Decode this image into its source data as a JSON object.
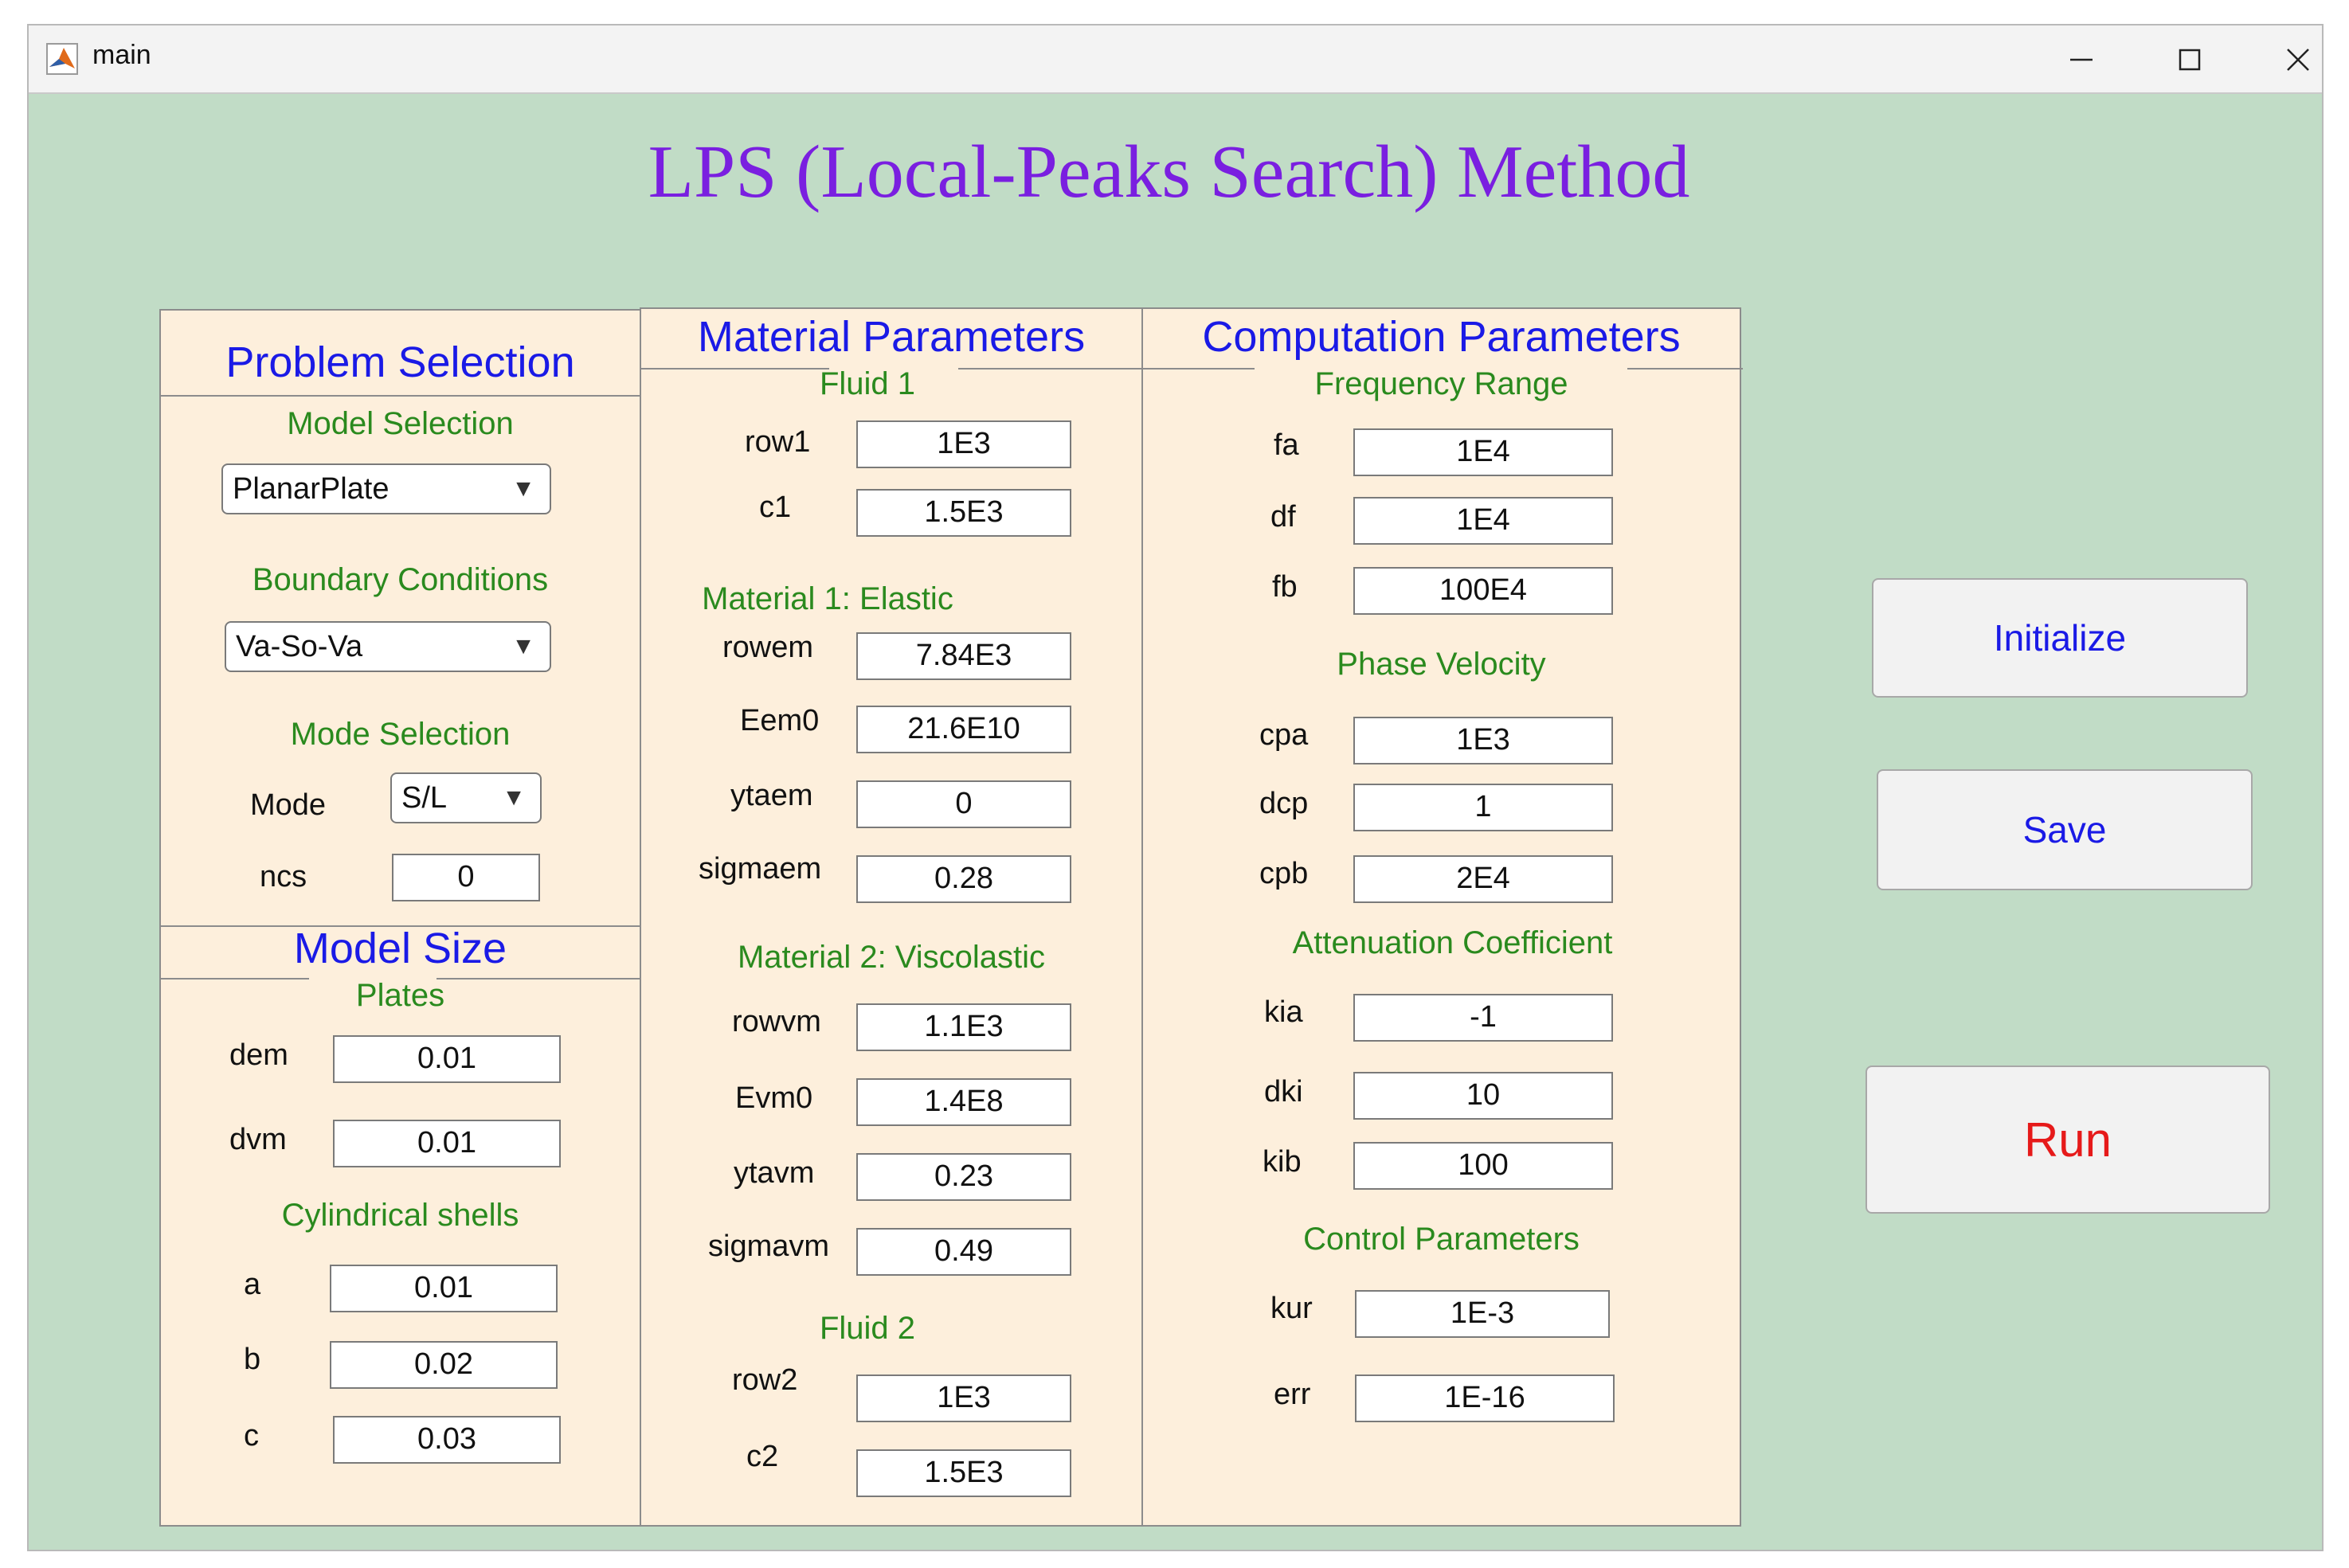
{
  "window": {
    "title": "main"
  },
  "heading": "LPS (Local-Peaks Search) Method",
  "problem_selection": {
    "title": "Problem Selection",
    "model_selection": {
      "label": "Model Selection",
      "value": "PlanarPlate"
    },
    "boundary_conditions": {
      "label": "Boundary Conditions",
      "value": "Va-So-Va"
    },
    "mode_selection": {
      "label": "Mode Selection",
      "mode_label": "Mode",
      "mode_value": "S/L",
      "ncs_label": "ncs",
      "ncs_value": "0"
    }
  },
  "model_size": {
    "title": "Model Size",
    "plates": {
      "label": "Plates",
      "dem_label": "dem",
      "dem": "0.01",
      "dvm_label": "dvm",
      "dvm": "0.01"
    },
    "shells": {
      "label": "Cylindrical shells",
      "a_label": "a",
      "a": "0.01",
      "b_label": "b",
      "b": "0.02",
      "c_label": "c",
      "c": "0.03"
    }
  },
  "material": {
    "title": "Material Parameters",
    "fluid1": {
      "label": "Fluid 1",
      "row1_label": "row1",
      "row1": "1E3",
      "c1_label": "c1",
      "c1": "1.5E3"
    },
    "elastic": {
      "label": "Material 1: Elastic",
      "rowem_label": "rowem",
      "rowem": "7.84E3",
      "eem0_label": "Eem0",
      "eem0": "21.6E10",
      "ytaem_label": "ytaem",
      "ytaem": "0",
      "sigmaem_label": "sigmaem",
      "sigmaem": "0.28"
    },
    "visco": {
      "label": "Material 2: Viscolastic",
      "rowvm_label": "rowvm",
      "rowvm": "1.1E3",
      "evm0_label": "Evm0",
      "evm0": "1.4E8",
      "ytavm_label": "ytavm",
      "ytavm": "0.23",
      "sigmavm_label": "sigmavm",
      "sigmavm": "0.49"
    },
    "fluid2": {
      "label": "Fluid 2",
      "row2_label": "row2",
      "row2": "1E3",
      "c2_label": "c2",
      "c2": "1.5E3"
    }
  },
  "computation": {
    "title": "Computation Parameters",
    "freq": {
      "label": "Frequency Range",
      "fa_label": "fa",
      "fa": "1E4",
      "df_label": "df",
      "df": "1E4",
      "fb_label": "fb",
      "fb": "100E4"
    },
    "phase": {
      "label": "Phase Velocity",
      "cpa_label": "cpa",
      "cpa": "1E3",
      "dcp_label": "dcp",
      "dcp": "1",
      "cpb_label": "cpb",
      "cpb": "2E4"
    },
    "atten": {
      "label": "Attenuation Coefficient",
      "kia_label": "kia",
      "kia": "-1",
      "dki_label": "dki",
      "dki": "10",
      "kib_label": "kib",
      "kib": "100"
    },
    "control": {
      "label": "Control Parameters",
      "kur_label": "kur",
      "kur": "1E-3",
      "err_label": "err",
      "err": "1E-16"
    }
  },
  "buttons": {
    "initialize": "Initialize",
    "save": "Save",
    "run": "Run"
  },
  "colors": {
    "background": "#c1dcc6",
    "panel": "#fdefdc",
    "heading": "#7a1fe0",
    "panel_title": "#1a1ae6",
    "section": "#2a8a1e",
    "run": "#e61a1a"
  },
  "icons": [
    "matlab-icon",
    "minimize-icon",
    "maximize-icon",
    "close-icon",
    "dropdown-arrow-icon"
  ]
}
